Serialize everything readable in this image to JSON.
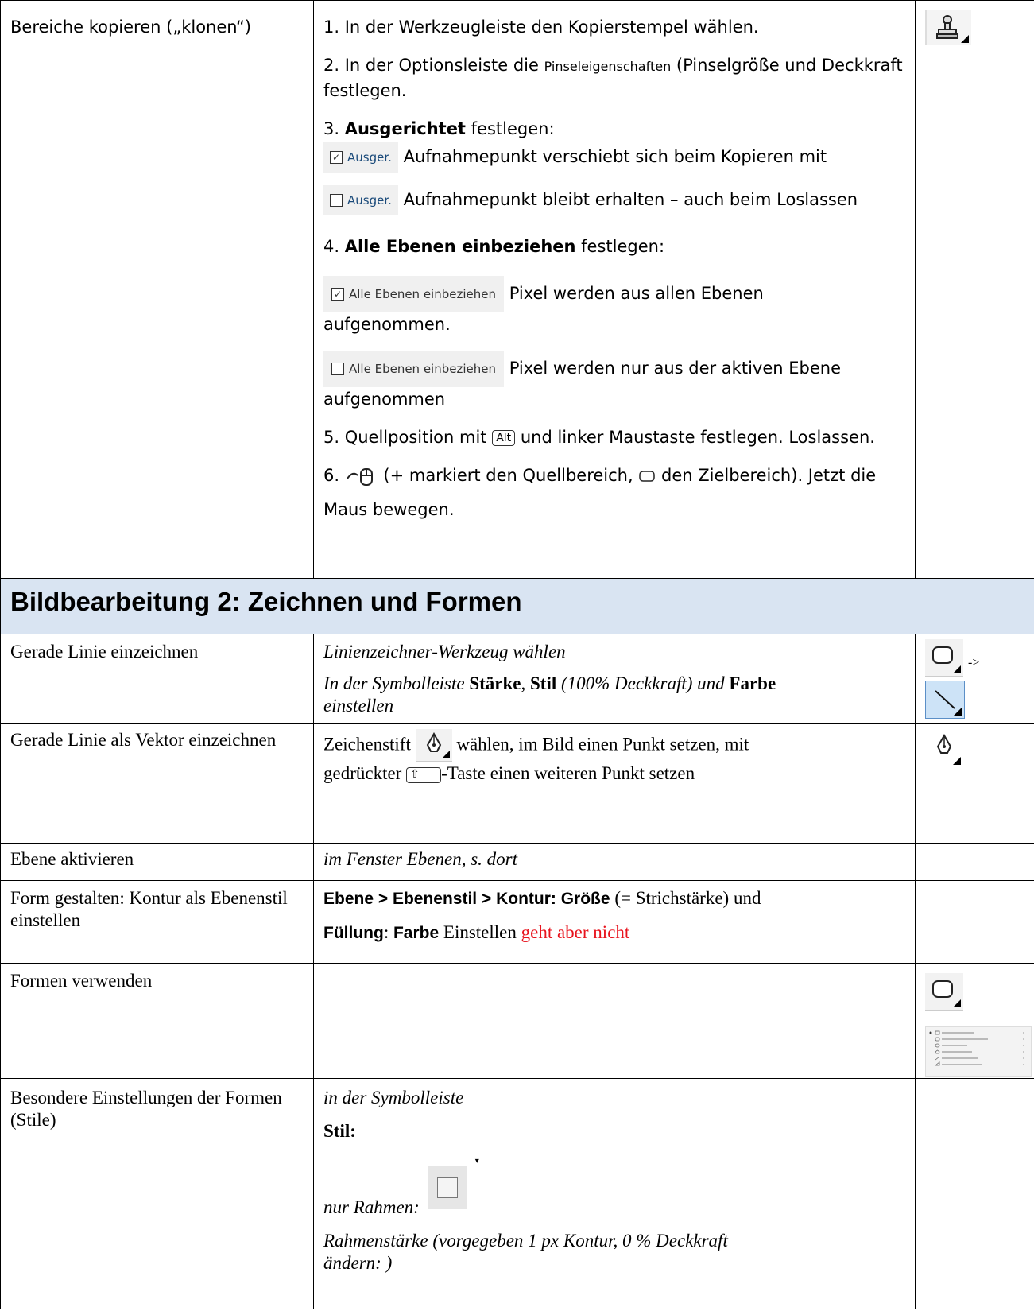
{
  "clone": {
    "label": "Bereiche kopieren („klonen“)",
    "step1": "1. In der Werkzeugleiste den Kopierstempel wählen.",
    "step2a": "2. In der Optionsleiste die ",
    "step2_small": "Pinseleigenschaften",
    "step2b": " (Pinselgröße und Deckkraft festlegen.",
    "step3_num": "3. ",
    "step3_bold": "Ausgerichtet",
    "step3_rest": " festlegen:",
    "chip_ausger": "Ausger.",
    "ausger_checked_text": "Aufnahmepunkt verschiebt sich beim Kopieren mit",
    "ausger_unchecked_text": "Aufnahmepunkt bleibt erhalten – auch beim Loslassen",
    "step4_num": "4. ",
    "step4_bold": "Alle Ebenen einbeziehen",
    "step4_rest": " festlegen:",
    "chip_alle": "Alle Ebenen einbeziehen",
    "alle_checked_text": "Pixel werden aus allen Ebenen",
    "alle_checked_text2": "aufgenommen.",
    "alle_unchecked_text": "Pixel werden nur aus der aktiven Ebene",
    "alle_unchecked_text2": "aufgenommen",
    "step5a": "5. Quellposition mit ",
    "step5_key": "Alt",
    "step5b": " und linker Maustaste festlegen. Loslassen.",
    "step6a": "6. ",
    "step6b": " (+ markiert den Quellbereich, ",
    "step6c": " den Zielbereich). Jetzt die",
    "step6d": "Maus bewegen."
  },
  "section_title": "Bildbearbeitung 2: Zeichnen und Formen",
  "rows": {
    "line_label": "Gerade Linie einzeichnen",
    "line_text1": "Linienzeichner-Werkzeug wählen",
    "line_text2a": "In der Symbolleiste ",
    "line_text2_b1": "Stärke",
    "line_text2b": ", ",
    "line_text2_b2": "Stil",
    "line_text2c": " (100% Deckkraft) und ",
    "line_text2_b3": "Farbe",
    "line_text2d": "einstellen",
    "arrow": "->",
    "vector_label": "Gerade Linie als Vektor einzeichnen",
    "vector_text1": "Zeichenstift ",
    "vector_text2": " wählen, im Bild einen Punkt setzen, mit",
    "vector_text3": "gedrückter ",
    "vector_text4": "-Taste einen weiteren Punkt setzen",
    "layer_label": "Ebene aktivieren",
    "layer_text": "im Fenster Ebenen, s. dort",
    "form_label": "Form gestalten: Kontur als Ebenenstil einstellen",
    "form_text_b1": "Ebene > Ebenenstil > Kontur: Größe",
    "form_text1": " (= Strichstärke) und",
    "form_text_b2": "Füllung",
    "form_text2": ": ",
    "form_text_b3": "Farbe",
    "form_text3": " Einstellen ",
    "form_text_red": "geht aber nicht",
    "shapes_label": "Formen verwenden",
    "special_label": "Besondere Einstellungen der Formen (Stile)",
    "special_text1": "in der Symbolleiste",
    "special_text2": "Stil:",
    "special_text3": "nur Rahmen:",
    "special_text4": "Rahmenstärke (vorgegeben 1 px Kontur, 0 % Deckkraft",
    "special_text5": "ändern: )"
  }
}
